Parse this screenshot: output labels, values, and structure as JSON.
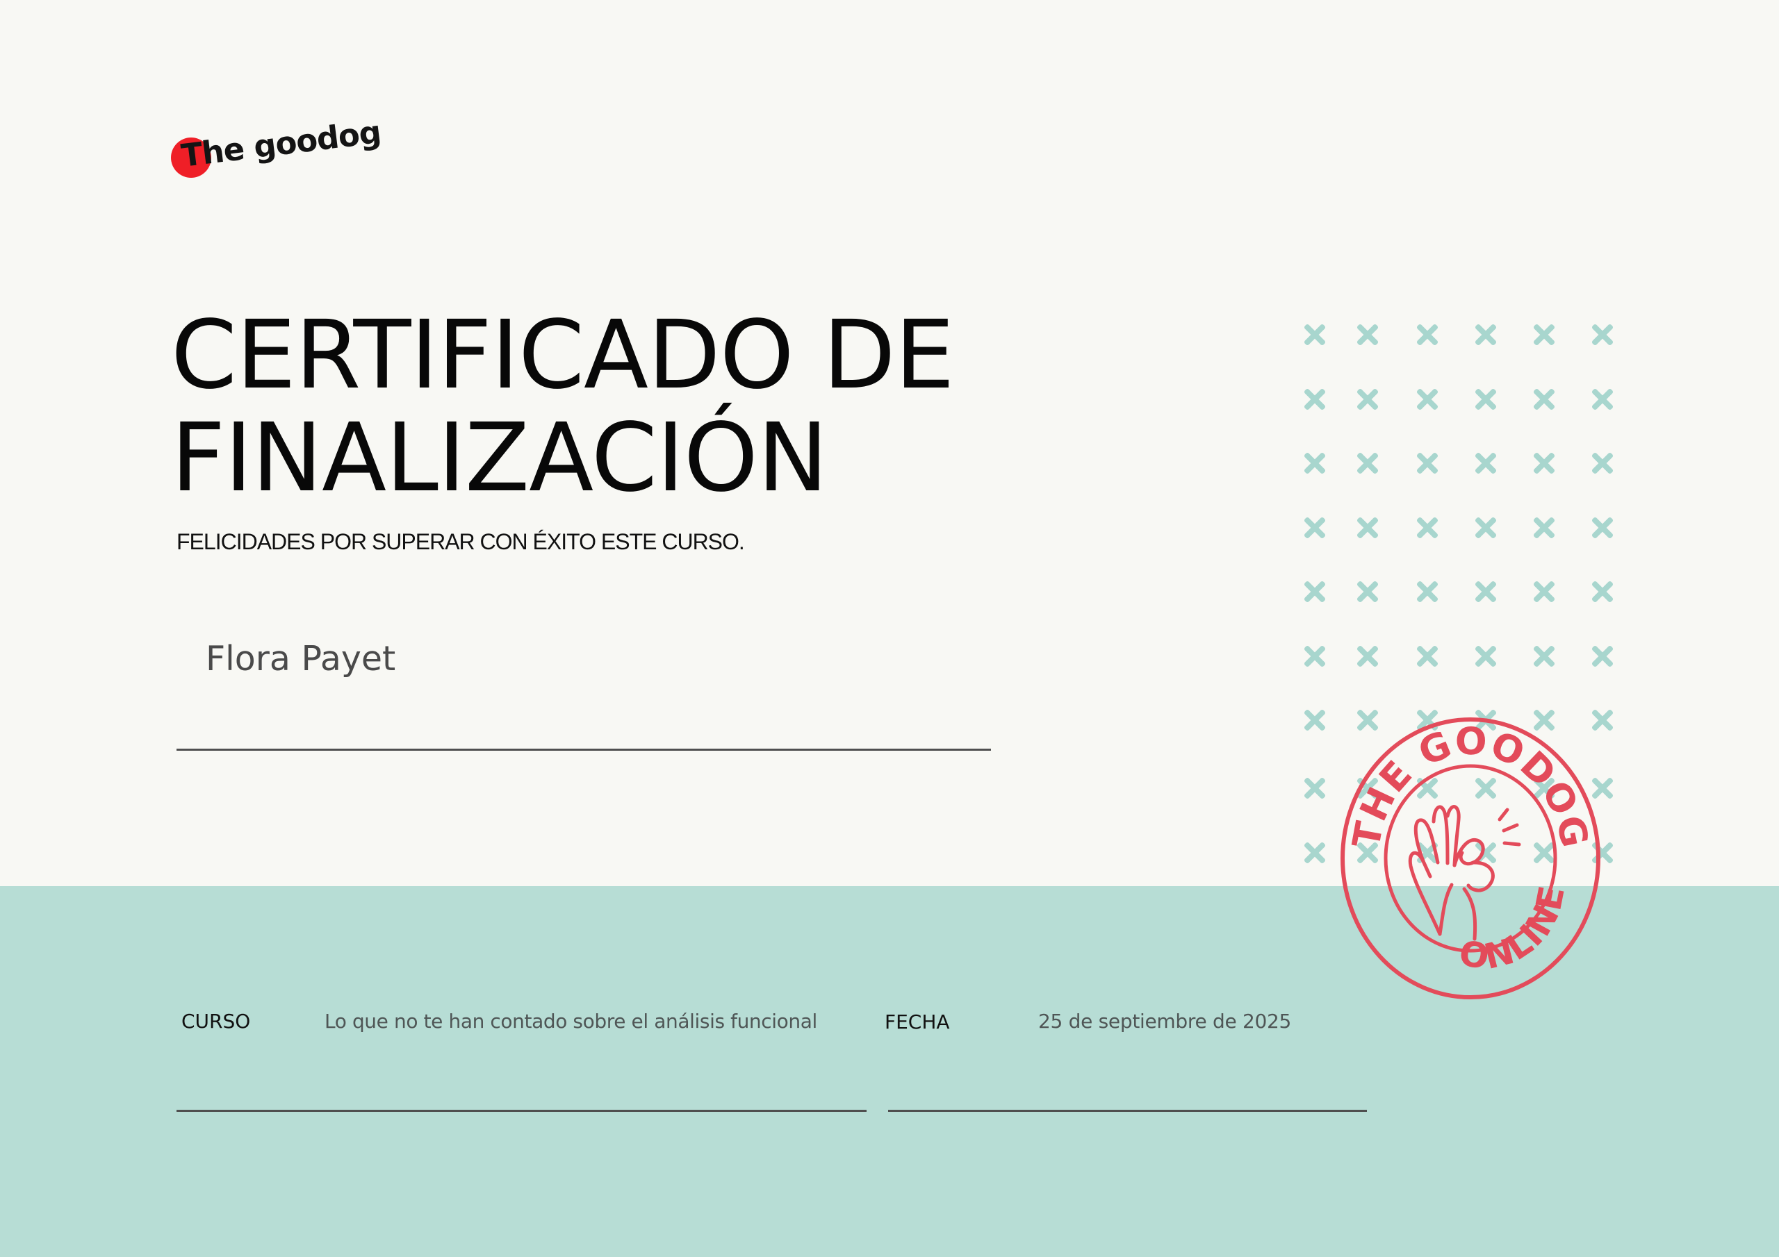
{
  "document": {
    "title": "CERTIFICADO DE\nFINALIZACIÓN",
    "subtitle": "FELICIDADES POR SUPERAR CON ÉXITO ESTE CURSO.",
    "recipient_name": "Flora Payet"
  },
  "brand": {
    "logo_text": "The goodog",
    "logo_icon": "red-circle-icon",
    "stamp_top_text": "THE GOODOG",
    "stamp_bottom_text": "ONLINE",
    "stamp_icon": "ok-hand-icon"
  },
  "details": {
    "course_label": "CURSO",
    "course_value": "Lo que no te han contado sobre el análisis funcional",
    "date_label": "FECHA",
    "date_value": "25 de septiembre de 2025"
  },
  "decorations": {
    "pattern_icon": "x-mark-icon"
  },
  "colors": {
    "background": "#f8f8f4",
    "bottom_band": "#b7ddd5",
    "pattern": "#a8d6ce",
    "brand_red": "#ef1f27",
    "stamp_red": "#e34b5a"
  }
}
